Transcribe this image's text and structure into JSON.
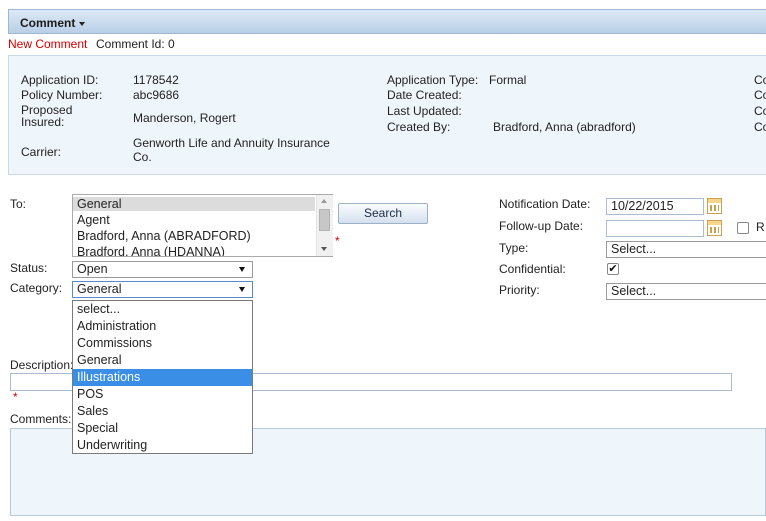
{
  "header": {
    "title": "Comment"
  },
  "comment_bar": {
    "new_comment": "New Comment",
    "comment_id": "Comment Id: 0"
  },
  "info": {
    "application_id_label": "Application ID:",
    "application_id": "1178542",
    "policy_number_label": "Policy Number:",
    "policy_number": "abc9686",
    "proposed_insured_label_1": "Proposed",
    "proposed_insured_label_2": "Insured:",
    "proposed_insured": "Manderson, Rogert",
    "carrier_label": "Carrier:",
    "carrier_line1": "Genworth Life and Annuity Insurance",
    "carrier_line2": "Co.",
    "application_type_label": "Application Type:",
    "application_type": "Formal",
    "date_created_label": "Date Created:",
    "last_updated_label": "Last Updated:",
    "created_by_label": "Created By:",
    "created_by": "Bradford, Anna (abradford)",
    "cut_labels": [
      "Co",
      "Co",
      "Co",
      "Co"
    ]
  },
  "form": {
    "to_label": "To:",
    "to_options": [
      "General",
      "Agent",
      "Bradford, Anna (ABRADFORD)",
      "Bradford, Anna (HDANNA)"
    ],
    "search_label": "Search",
    "required_mark": "*",
    "status_label": "Status:",
    "status_value": "Open",
    "category_label": "Category:",
    "category_value": "General",
    "category_options": [
      "select...",
      "Administration",
      "Commissions",
      "General",
      "Illustrations",
      "POS",
      "Sales",
      "Special",
      "Underwriting"
    ],
    "category_highlighted": "Illustrations",
    "description_label": "Description:",
    "comments_label": "Comments:",
    "notification_date_label": "Notification Date:",
    "notification_date": "10/22/2015",
    "followup_date_label": "Follow-up Date:",
    "followup_date": "",
    "followup_cut_label": "R",
    "type_label": "Type:",
    "type_value": "Select...",
    "confidential_label": "Confidential:",
    "confidential_checked": true,
    "priority_label": "Priority:",
    "priority_value": "Select..."
  },
  "colors": {
    "required": "#d40000",
    "highlight": "#3a8ee6",
    "panel": "#eef5fb"
  }
}
